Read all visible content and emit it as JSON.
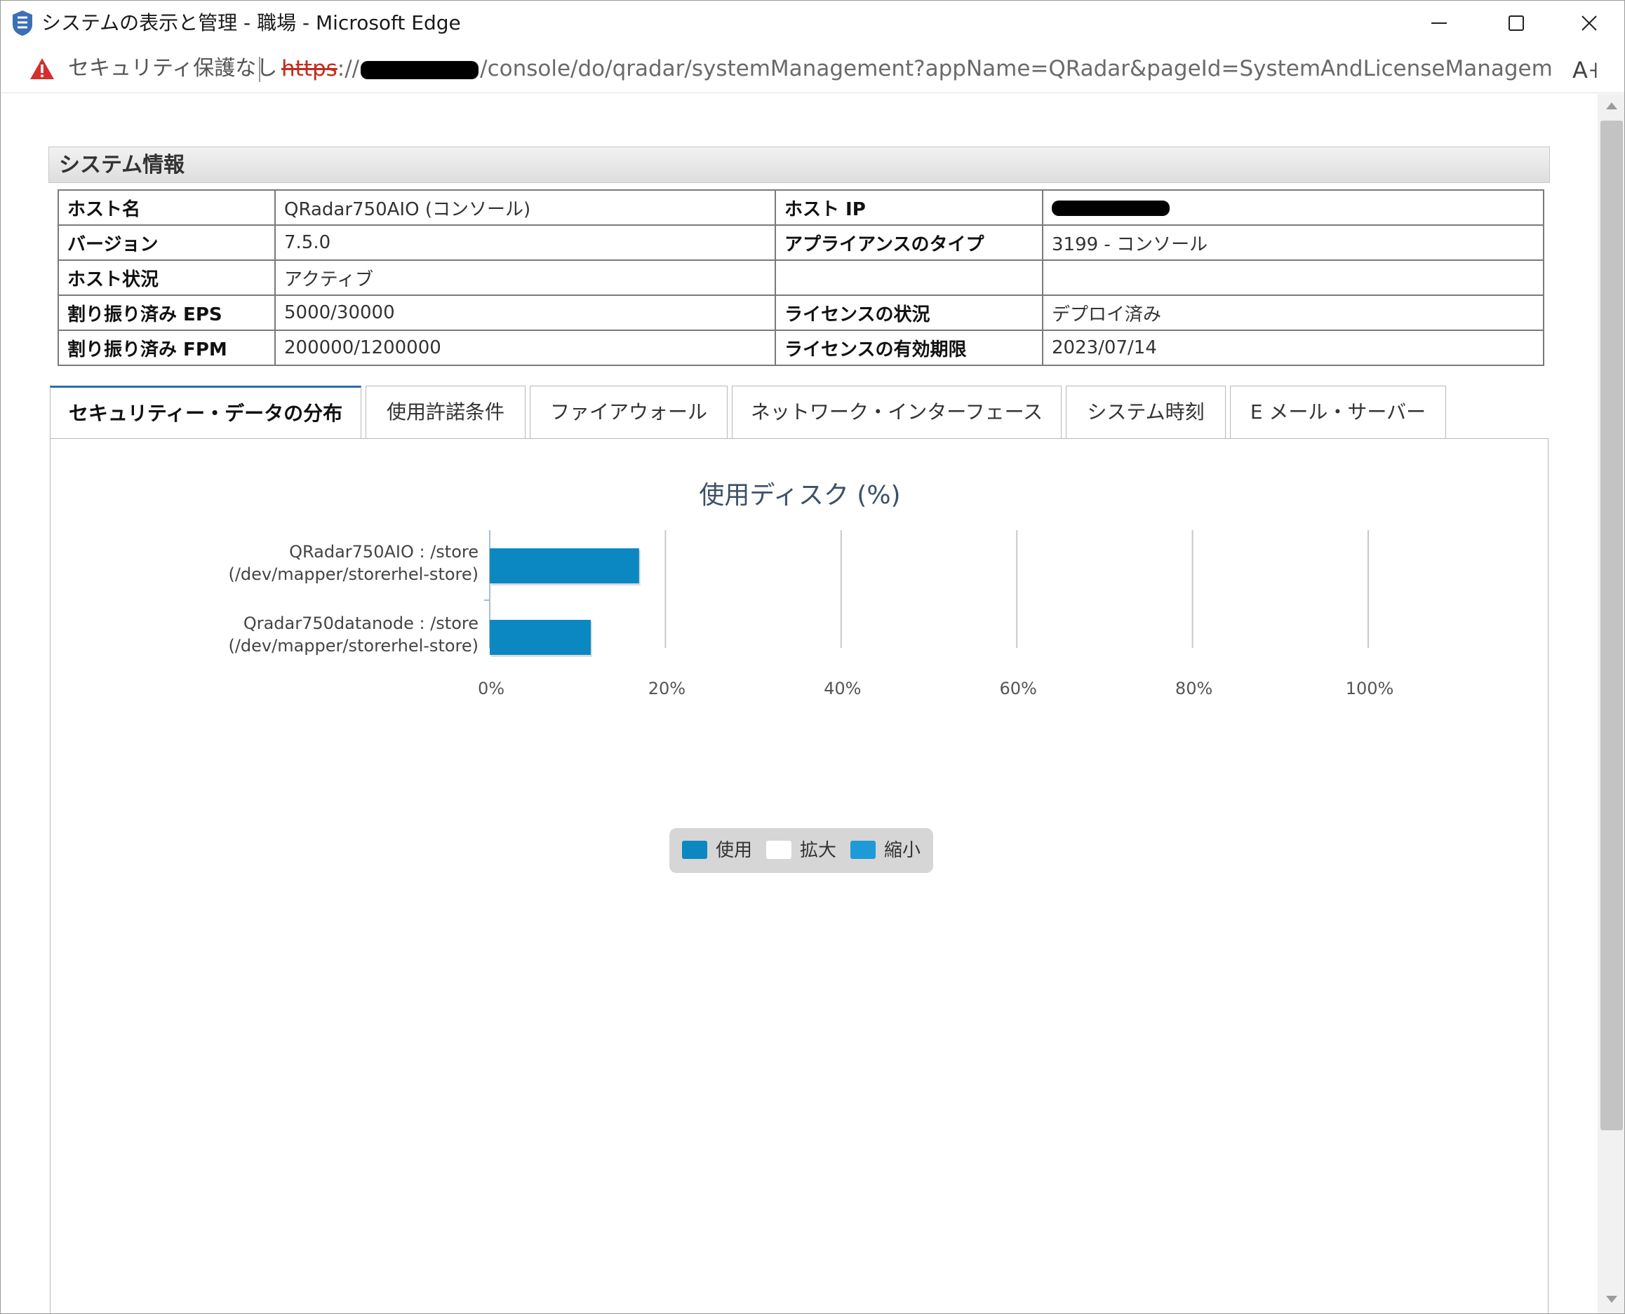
{
  "window": {
    "title": "システムの表示と管理 - 職場 - Microsoft Edge"
  },
  "address_bar": {
    "security_label": "セキュリティ保護なし",
    "url_scheme": "https",
    "url_sep": "://",
    "url_path": "/console/do/qradar/systemManagement?appName=QRadar&pageId=SystemAndLicenseManagementDetails..."
  },
  "section": {
    "title": "システム情報"
  },
  "system_info": {
    "rows": [
      {
        "label1": "ホスト名",
        "value1": "QRadar750AIO (コンソール)",
        "label2": "ホスト IP",
        "value2": ""
      },
      {
        "label1": "バージョン",
        "value1": "7.5.0",
        "label2": "アプライアンスのタイプ",
        "value2": "3199 - コンソール"
      },
      {
        "label1": "ホスト状況",
        "value1": "アクティブ",
        "label2": "",
        "value2": ""
      },
      {
        "label1": "割り振り済み EPS",
        "value1": "5000/30000",
        "label2": "ライセンスの状況",
        "value2": "デプロイ済み"
      },
      {
        "label1": "割り振り済み FPM",
        "value1": "200000/1200000",
        "label2": "ライセンスの有効期限",
        "value2": "2023/07/14"
      }
    ]
  },
  "tabs": [
    {
      "label": "セキュリティー・データの分布",
      "active": true
    },
    {
      "label": "使用許諾条件",
      "active": false
    },
    {
      "label": "ファイアウォール",
      "active": false
    },
    {
      "label": "ネットワーク・インターフェース",
      "active": false
    },
    {
      "label": "システム時刻",
      "active": false
    },
    {
      "label": "E メール・サーバー",
      "active": false
    }
  ],
  "chart_data": {
    "type": "bar",
    "orientation": "horizontal",
    "title": "使用ディスク (%)",
    "categories": [
      [
        "QRadar750AIO : /store",
        "(/dev/mapper/storerhel-store)"
      ],
      [
        "Qradar750datanode : /store",
        "(/dev/mapper/storerhel-store)"
      ]
    ],
    "series": [
      {
        "name": "使用",
        "values": [
          17,
          11.5
        ],
        "color": "#0b88c1"
      }
    ],
    "xlim": [
      0,
      100
    ],
    "ticks": [
      "0%",
      "20%",
      "40%",
      "60%",
      "80%",
      "100%"
    ],
    "grid": true,
    "legend": {
      "placement": "bottom-center",
      "items": [
        {
          "name": "使用",
          "color": "#0b88c1"
        },
        {
          "name": "拡大",
          "color": "#ffffff"
        },
        {
          "name": "縮小",
          "color": "#1e9bd6"
        }
      ]
    }
  },
  "colors": {
    "bar": "#0b88c1",
    "tab_accent": "#2b6cb0",
    "warning": "#d32f2f"
  }
}
